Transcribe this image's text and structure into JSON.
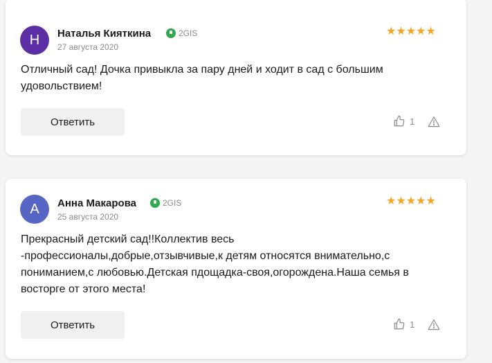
{
  "reviews": [
    {
      "avatar_letter": "Н",
      "avatar_color": "#5b2ea6",
      "author": "Наталья Кияткина",
      "source": "2GIS",
      "source_icon": "2gis-pin-icon",
      "date": "27 августа 2020",
      "rating": 5,
      "stars": "★★★★★",
      "text": "Отличный сад! Дочка привыкла за пару дней и ходит в сад с большим удовольствием!",
      "reply_label": "Ответить",
      "likes": "1"
    },
    {
      "avatar_letter": "А",
      "avatar_color": "#5566c4",
      "author": "Анна Макарова",
      "source": "2GIS",
      "source_icon": "2gis-pin-icon",
      "date": "25 августа 2020",
      "rating": 5,
      "stars": "★★★★★",
      "text": "Прекрасный детский сад!!Коллектив весь -профессионалы,добрые,отзывчивые,к детям относятся внимательно,с пониманием,с любовью.Детская пдощадка-своя,огорождена.Наша семья в восторге от этого места!",
      "reply_label": "Ответить",
      "likes": "1"
    }
  ],
  "colors": {
    "star": "#f5a623",
    "source_green": "#2fa84f",
    "muted": "#8a8a8a",
    "button_bg": "#f0f0f0"
  }
}
